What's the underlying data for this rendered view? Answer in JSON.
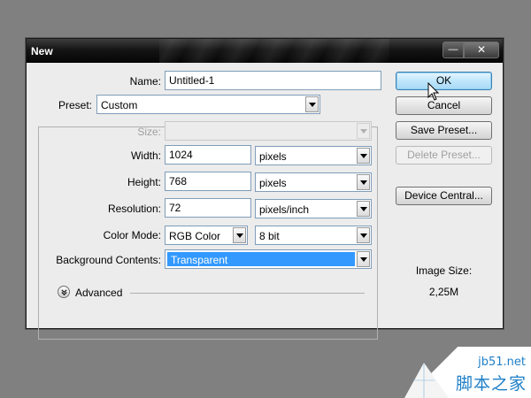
{
  "dialog": {
    "title": "New",
    "title_buttons": {
      "minimize": "—",
      "close": "✕"
    }
  },
  "form": {
    "name_label": "Name:",
    "name_value": "Untitled-1",
    "preset_label": "Preset:",
    "preset_value": "Custom",
    "size_label": "Size:",
    "size_value": "",
    "width_label": "Width:",
    "width_value": "1024",
    "width_unit": "pixels",
    "height_label": "Height:",
    "height_value": "768",
    "height_unit": "pixels",
    "resolution_label": "Resolution:",
    "resolution_value": "72",
    "resolution_unit": "pixels/inch",
    "color_mode_label": "Color Mode:",
    "color_mode_value": "RGB Color",
    "bit_depth_value": "8 bit",
    "background_label": "Background Contents:",
    "background_value": "Transparent",
    "advanced_label": "Advanced"
  },
  "buttons": {
    "ok": "OK",
    "cancel": "Cancel",
    "save_preset": "Save Preset...",
    "delete_preset": "Delete Preset...",
    "device_central": "Device Central..."
  },
  "image_size": {
    "label": "Image Size:",
    "value": "2,25M"
  },
  "watermark": {
    "url": "jb51.net",
    "text": "脚本之家"
  },
  "colors": {
    "background": "#808080",
    "titlebar": "#0a0a0a",
    "selection": "#3399ff",
    "default_button": "#bee6fd",
    "watermark_text": "#1e7fc7"
  },
  "icons": [
    "dropdown-arrow-icon",
    "expand-chevron-icon",
    "mouse-pointer-icon",
    "minimize-icon",
    "close-icon"
  ]
}
